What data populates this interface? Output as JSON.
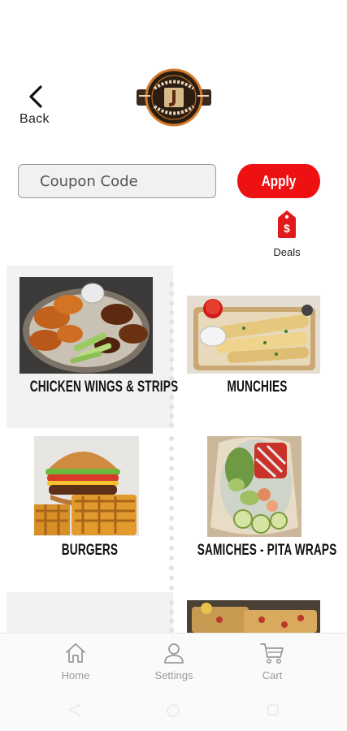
{
  "header": {
    "back_label": "Back"
  },
  "coupon": {
    "placeholder": "Coupon Code",
    "value": "",
    "apply_label": "Apply"
  },
  "deals": {
    "label": "Deals"
  },
  "categories": [
    {
      "label": "CHICKEN WINGS & STRIPS"
    },
    {
      "label": "MUNCHIES"
    },
    {
      "label": "BURGERS"
    },
    {
      "label": "SAMICHES - PITA WRAPS"
    }
  ],
  "bottom_nav": [
    {
      "label": "Home",
      "icon": "home-icon"
    },
    {
      "label": "Settings",
      "icon": "user-icon"
    },
    {
      "label": "Cart",
      "icon": "cart-icon"
    }
  ],
  "colors": {
    "accent": "#ee1111",
    "nav_gray": "#9a9a9a",
    "panel": "#f2f2f2"
  }
}
